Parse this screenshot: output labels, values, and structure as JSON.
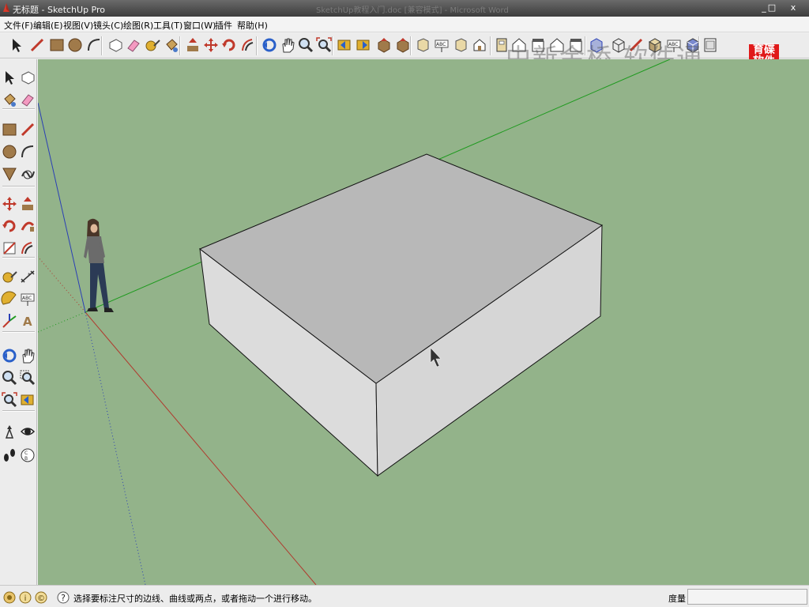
{
  "window": {
    "title": "无标题 - SketchUp Pro",
    "background_title": "SketchUp教程入门.doc [兼容模式] - Microsoft Word",
    "controls": {
      "minimize": "_",
      "maximize": "□",
      "close": "x"
    }
  },
  "menus": [
    "文件(F)",
    "编辑(E)",
    "视图(V)",
    "镜头(C)",
    "绘图(R)",
    "工具(T)",
    "窗口(W)",
    "插件",
    "帮助(H)"
  ],
  "watermark": "中新金桥 软件通",
  "logo": {
    "line1": "育碟",
    "line2": "软件",
    "color": "#e01919"
  },
  "toolbar_icons": [
    "select-icon",
    "line-icon",
    "rectangle-icon",
    "circle-icon",
    "arc-icon",
    "make-component-icon",
    "eraser-icon",
    "tape-measure-icon",
    "paint-bucket-icon",
    "push-pull-icon",
    "move-icon",
    "rotate-icon",
    "offset-icon",
    "orbit-icon",
    "pan-icon",
    "zoom-icon",
    "zoom-extents-icon",
    "previous-view-icon",
    "next-view-icon",
    "get-models-icon",
    "share-model-icon",
    "share-component-icon",
    "get-photo-texture-icon",
    "component-icon",
    "iso-view-icon",
    "top-view-icon",
    "front-view-icon",
    "right-view-icon",
    "back-view-icon",
    "left-view-icon",
    "xray-icon",
    "wireframe-icon",
    "hidden-line-icon",
    "shaded-icon",
    "shaded-texture-icon",
    "monochrome-icon",
    "section-icon"
  ],
  "palette_icons": [
    [
      "select-icon",
      "make-component-icon"
    ],
    [
      "paint-bucket-icon",
      "eraser-icon"
    ],
    [
      "rectangle-icon",
      "line-icon"
    ],
    [
      "circle-icon",
      "arc-icon"
    ],
    [
      "polygon-icon",
      "freehand-icon"
    ],
    [
      "move-icon",
      "push-pull-icon"
    ],
    [
      "rotate-icon",
      "follow-me-icon"
    ],
    [
      "scale-icon",
      "offset-icon"
    ],
    [
      "tape-measure-icon",
      "dimension-icon"
    ],
    [
      "protractor-icon",
      "text-icon"
    ],
    [
      "axes-icon",
      "3d-text-icon"
    ],
    [
      "orbit-icon",
      "pan-icon"
    ],
    [
      "zoom-icon",
      "zoom-window-icon"
    ],
    [
      "zoom-extents-icon",
      "previous-icon"
    ],
    [
      "position-camera-icon",
      "look-around-icon"
    ],
    [
      "walk-icon",
      "section-plane-icon"
    ]
  ],
  "status": {
    "hint": "选择要标注尺寸的边线、曲线或两点，或者拖动一个进行移动。",
    "measure_label": "度量",
    "measure_value": "",
    "icons": [
      "geo-location-icon",
      "credits-icon",
      "user-icon",
      "help-icon"
    ]
  },
  "colors": {
    "viewport_bg": "#93b38a",
    "axis_red": "#b03a2e",
    "axis_green": "#1f9a1f",
    "axis_blue": "#2a3fb5",
    "box_top": "#b8b8b8",
    "box_side": "#dcdcdc"
  }
}
